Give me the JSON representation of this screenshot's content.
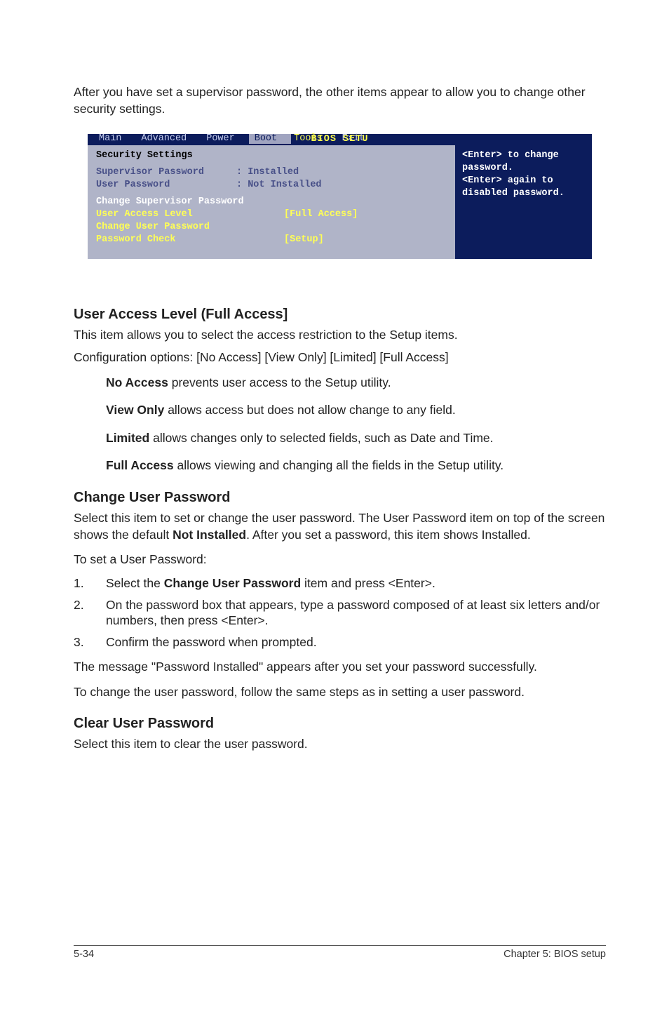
{
  "intro": "After you have set a supervisor password, the other items appear to allow you to change other security settings.",
  "bios": {
    "title": "BIOS SETU",
    "menu": {
      "main": "Main",
      "advanced": "Advanced",
      "power": "Power",
      "boot": "Boot",
      "tools": "Tools",
      "exit": "Exit"
    },
    "section_title": "Security Settings",
    "rows": {
      "sup_label": "Supervisor Password",
      "sup_value": ": Installed",
      "user_label": "User Password",
      "user_value": ": Not Installed",
      "change_sup": "Change Supervisor Password",
      "ual_label": "User Access Level",
      "ual_value": "[Full Access]",
      "change_user": "Change User Password",
      "pw_check_label": "Password Check",
      "pw_check_value": "[Setup]"
    },
    "help": {
      "l1": "<Enter> to change",
      "l2": "password.",
      "l3": "<Enter> again to",
      "l4": "disabled password."
    }
  },
  "ual": {
    "heading": "User Access Level (Full Access]",
    "desc1": "This item allows you to select the access restriction to the Setup items.",
    "desc2": "Configuration options: [No Access] [View Only] [Limited] [Full Access]",
    "no_access_b": "No Access",
    "no_access_t": " prevents user access to the Setup utility.",
    "view_only_b": "View Only",
    "view_only_t": " allows access but does not allow change to any field.",
    "limited_b": "Limited",
    "limited_t": " allows changes only to selected fields, such as Date and Time.",
    "full_access_b": "Full Access",
    "full_access_t": " allows viewing and changing all the fields in the Setup utility."
  },
  "cup": {
    "heading": "Change User Password",
    "p1a": "Select this item to set or change the user password. The User Password item on top of the screen shows the default ",
    "p1b": "Not Installed",
    "p1c": ". After you set a password, this item shows Installed.",
    "p2": "To set a User Password:",
    "s1a": "Select the ",
    "s1b": "Change User Password",
    "s1c": " item and press <Enter>.",
    "s2": "On the password box that appears, type a password composed of at least six letters and/or numbers, then press <Enter>.",
    "s3": "Confirm the password when prompted.",
    "p3": "The message \"Password Installed\" appears after you set your password successfully.",
    "p4": "To change the user password, follow the same steps as in setting a user password."
  },
  "clp": {
    "heading": "Clear User Password",
    "p1": "Select this item to clear the user password."
  },
  "footer": {
    "left": "5-34",
    "right": "Chapter 5: BIOS setup"
  }
}
